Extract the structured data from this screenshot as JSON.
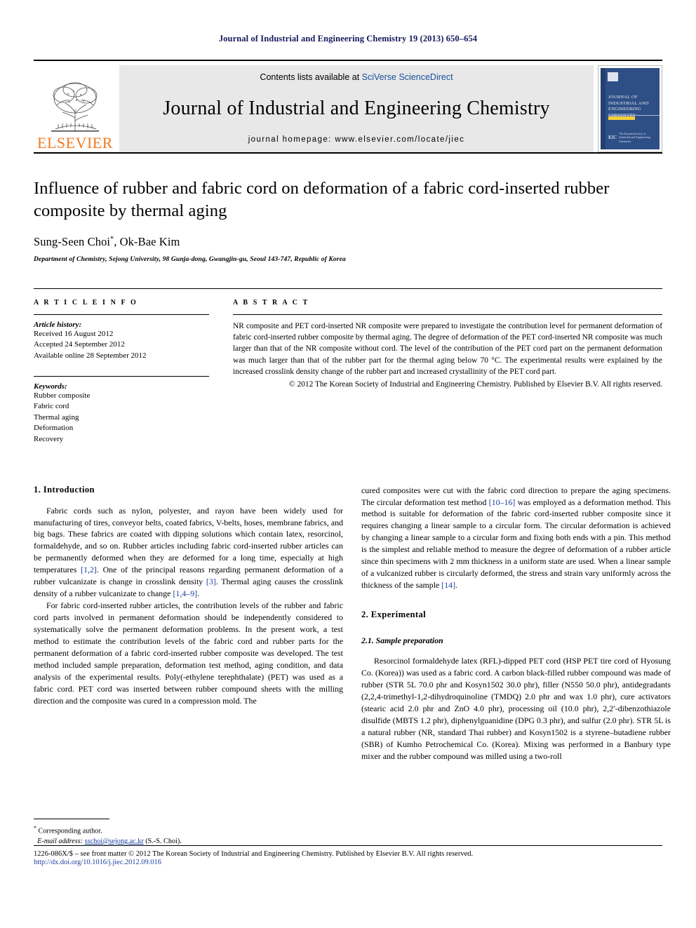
{
  "running_head": "Journal of Industrial and Engineering Chemistry 19 (2013) 650–654",
  "masthead": {
    "publisher_name": "ELSEVIER",
    "contents_prefix": "Contents lists available at ",
    "contents_link": "SciVerse ScienceDirect",
    "journal_title": "Journal of Industrial and Engineering Chemistry",
    "homepage": "journal homepage: www.elsevier.com/locate/jiec",
    "cover": {
      "title": "Journal of Industrial and Engineering Chemistry",
      "society_mark": "KIC",
      "society_text": "The Korean Society of Industrial and Engineering Chemistry"
    },
    "link_color": "#1a4f9c",
    "brand_color": "#f47920"
  },
  "article": {
    "title": "Influence of rubber and fabric cord on deformation of a fabric cord-inserted rubber composite by thermal aging",
    "authors": "Sung-Seen Choi",
    "author_star": "*",
    "authors_rest": ", Ok-Bae Kim",
    "affiliation": "Department of Chemistry, Sejong University, 98 Gunja-dong, Gwangjin-gu, Seoul 143-747, Republic of Korea"
  },
  "article_info": {
    "label": "A R T I C L E   I N F O",
    "history_label": "Article history:",
    "received": "Received 16 August 2012",
    "accepted": "Accepted 24 September 2012",
    "available": "Available online 28 September 2012",
    "keywords_label": "Keywords:",
    "keywords": [
      "Rubber composite",
      "Fabric cord",
      "Thermal aging",
      "Deformation",
      "Recovery"
    ]
  },
  "abstract": {
    "label": "A B S T R A C T",
    "text": "NR composite and PET cord-inserted NR composite were prepared to investigate the contribution level for permanent deformation of fabric cord-inserted rubber composite by thermal aging. The degree of deformation of the PET cord-inserted NR composite was much larger than that of the NR composite without cord. The level of the contribution of the PET cord part on the permanent deformation was much larger than that of the rubber part for the thermal aging below 70 °C. The experimental results were explained by the increased crosslink density change of the rubber part and increased crystallinity of the PET cord part.",
    "copyright": "© 2012 The Korean Society of Industrial and Engineering Chemistry. Published by Elsevier B.V. All rights reserved."
  },
  "body": {
    "intro_heading": "1. Introduction",
    "intro_p1_a": "Fabric cords such as nylon, polyester, and rayon have been widely used for manufacturing of tires, conveyor belts, coated fabrics, V-belts, hoses, membrane fabrics, and big bags. These fabrics are coated with dipping solutions which contain latex, resorcinol, formaldehyde, and so on. Rubber articles including fabric cord-inserted rubber articles can be permanently deformed when they are deformed for a long time, especially at high temperatures ",
    "intro_cite1": "[1,2]",
    "intro_p1_b": ". One of the principal reasons regarding permanent deformation of a rubber vulcanizate is change in crosslink density ",
    "intro_cite2": "[3]",
    "intro_p1_c": ". Thermal aging causes the crosslink density of a rubber vulcanizate to change ",
    "intro_cite3": "[1,4–9]",
    "intro_p1_d": ".",
    "intro_p2": "For fabric cord-inserted rubber articles, the contribution levels of the rubber and fabric cord parts involved in permanent deformation should be independently considered to systematically solve the permanent deformation problems. In the present work, a test method to estimate the contribution levels of the fabric cord and rubber parts for the permanent deformation of a fabric cord-inserted rubber composite was developed. The test method included sample preparation, deformation test method, aging condition, and data analysis of the experimental results. Poly(-ethylene terephthalate) (PET) was used as a fabric cord. PET cord was inserted between rubber compound sheets with the milling direction and the composite was cured in a compression mold. The",
    "right_p1_a": "cured composites were cut with the fabric cord direction to prepare the aging specimens. The circular deformation test method ",
    "right_cite1": "[10–16]",
    "right_p1_b": " was employed as a deformation method. This method is suitable for deformation of the fabric cord-inserted rubber composite since it requires changing a linear sample to a circular form. The circular deformation is achieved by changing a linear sample to a circular form and fixing both ends with a pin. This method is the simplest and reliable method to measure the degree of deformation of a rubber article since thin specimens with 2 mm thickness in a uniform state are used. When a linear sample of a vulcanized rubber is circularly deformed, the stress and strain vary uniformly across the thickness of the sample ",
    "right_cite2": "[14]",
    "right_p1_c": ".",
    "exp_heading": "2. Experimental",
    "exp_sub_heading": "2.1. Sample preparation",
    "exp_p1": "Resorcinol formaldehyde latex (RFL)-dipped PET cord (HSP PET tire cord of Hyosung Co. (Korea)) was used as a fabric cord. A carbon black-filled rubber compound was made of rubber (STR 5L 70.0 phr and Kosyn1502 30.0 phr), filler (N550 50.0 phr), antidegradants (2,2,4-trimethyl-1,2-dihydroquinoline (TMDQ) 2.0 phr and wax 1.0 phr), cure activators (stearic acid 2.0 phr and ZnO 4.0 phr), processing oil (10.0 phr), 2,2′-dibenzothiazole disulfide (MBTS 1.2 phr), diphenylguanidine (DPG 0.3 phr), and sulfur (2.0 phr). STR 5L is a natural rubber (NR, standard Thai rubber) and Kosyn1502 is a styrene–butadiene rubber (SBR) of Kumho Petrochemical Co. (Korea). Mixing was performed in a Banbury type mixer and the rubber compound was milled using a two-roll"
  },
  "footnote": {
    "star": "*",
    "corresponding": " Corresponding author.",
    "email_label": "E-mail address:",
    "email": "sschoi@sejong.ac.kr",
    "email_suffix": " (S.-S. Choi)."
  },
  "page_footer": {
    "issn_line": "1226-086X/$ – see front matter © 2012 The Korean Society of Industrial and Engineering Chemistry. Published by Elsevier B.V. All rights reserved.",
    "doi": "http://dx.doi.org/10.1016/j.jiec.2012.09.016"
  }
}
